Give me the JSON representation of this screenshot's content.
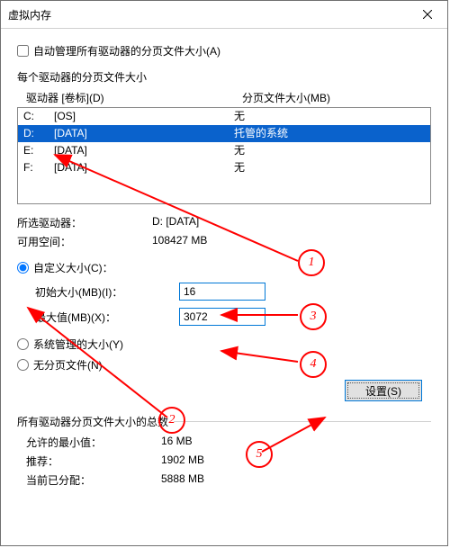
{
  "title": "虚拟内存",
  "auto_manage": "自动管理所有驱动器的分页文件大小(A)",
  "per_drive_title": "每个驱动器的分页文件大小",
  "header": {
    "drive": "驱动器  [卷标](D)",
    "size": "分页文件大小(MB)"
  },
  "drives": [
    {
      "letter": "C:",
      "label": "[OS]",
      "size": "无",
      "selected": false
    },
    {
      "letter": "D:",
      "label": "[DATA]",
      "size": "托管的系统",
      "selected": true
    },
    {
      "letter": "E:",
      "label": "[DATA]",
      "size": "无",
      "selected": false
    },
    {
      "letter": "F:",
      "label": "[DATA]",
      "size": "无",
      "selected": false
    }
  ],
  "selected": {
    "label_drive": "所选驱动器：",
    "value_drive": "D:  [DATA]",
    "label_free": "可用空间：",
    "value_free": "108427 MB"
  },
  "radios": {
    "custom": "自定义大小(C)：",
    "initial_label": "初始大小(MB)(I)：",
    "initial_value": "16",
    "max_label": "最大值(MB)(X)：",
    "max_value": "3072",
    "system": "系统管理的大小(Y)",
    "none": "无分页文件(N)"
  },
  "set_button": "设置(S)",
  "totals_title": "所有驱动器分页文件大小的总数",
  "totals": {
    "min_label": "允许的最小值：",
    "min_value": "16 MB",
    "rec_label": "推荐：",
    "rec_value": "1902 MB",
    "cur_label": "当前已分配：",
    "cur_value": "5888 MB"
  },
  "steps": [
    "1",
    "2",
    "3",
    "4",
    "5"
  ]
}
